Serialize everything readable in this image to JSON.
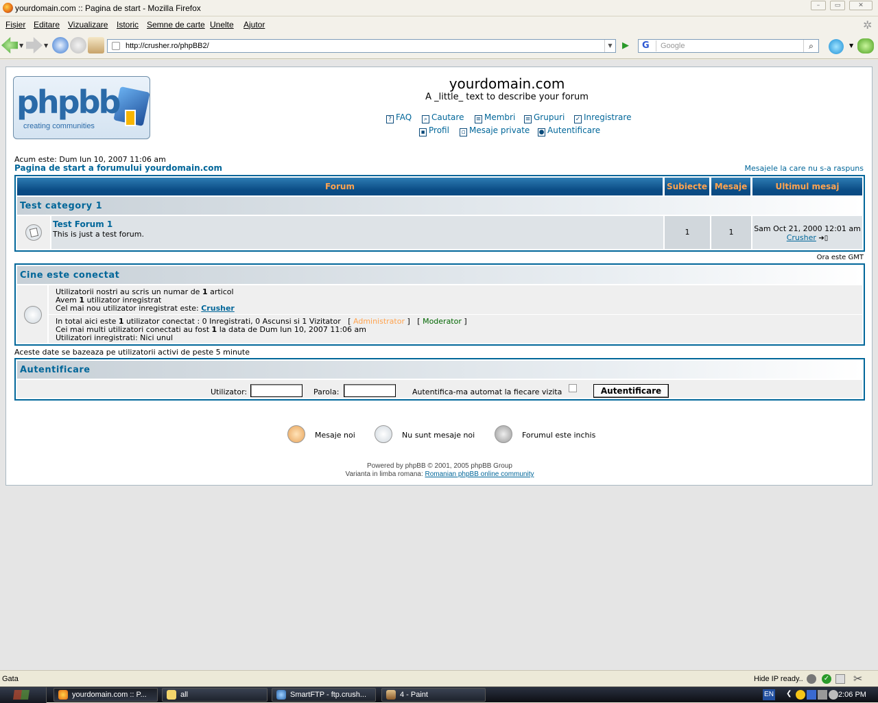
{
  "window": {
    "title": "yourdomain.com :: Pagina de start - Mozilla Firefox"
  },
  "menu": [
    "Fișier",
    "Editare",
    "Vizualizare",
    "Istoric",
    "Semne de carte",
    "Unelte",
    "Ajutor"
  ],
  "nav": {
    "url": "http://crusher.ro/phpBB2/",
    "search_placeholder": "Google"
  },
  "header": {
    "logo_text": "phpbb",
    "logo_tagline": "creating communities",
    "site_title": "yourdomain.com",
    "site_desc": "A _little_ text to describe your forum",
    "links_row1": [
      "FAQ",
      "Cautare",
      "Membri",
      "Grupuri",
      "Inregistrare"
    ],
    "links_row2": [
      "Profil",
      "Mesaje private",
      "Autentificare"
    ]
  },
  "info": {
    "now": "Acum este: Dum Iun 10, 2007 11:06 am",
    "index_link": "Pagina de start a forumului yourdomain.com",
    "unanswered": "Mesajele la care nu s-a raspuns"
  },
  "forum_table": {
    "headers": [
      "Forum",
      "Subiecte",
      "Mesaje",
      "Ultimul mesaj"
    ],
    "category": "Test category 1",
    "forum": {
      "name": "Test Forum 1",
      "desc": "This is just a test forum.",
      "topics": "1",
      "posts": "1",
      "last_post_date": "Sam Oct 21, 2000 12:01 am",
      "last_post_user": "Crusher"
    },
    "timezone": "Ora este GMT"
  },
  "whos_online": {
    "title": "Cine este conectat",
    "l1_pre": "Utilizatorii nostri au scris un numar de ",
    "l1_num": "1",
    "l1_post": " articol",
    "l2_pre": "Avem ",
    "l2_num": "1",
    "l2_post": " utilizator inregistrat",
    "l3_pre": "Cel mai nou utilizator inregistrat este: ",
    "l3_user": "Crusher",
    "l4_pre": "In total aici este ",
    "l4_num": "1",
    "l4_post": " utilizator conectat : 0 Inregistrati, 0 Ascunsi si 1 Vizitator   [ ",
    "admin": "Administrator",
    "mid": " ]   [ ",
    "mod": "Moderator",
    "end": " ]",
    "l5_pre": "Cei mai multi utilizatori conectati au fost ",
    "l5_num": "1",
    "l5_post": " la data de Dum Iun 10, 2007 11:06 am",
    "l6": "Utilizatori inregistrati: Nici unul",
    "note": "Aceste date se bazeaza pe utilizatorii activi de peste 5 minute"
  },
  "login": {
    "title": "Autentificare",
    "user_label": "Utilizator:",
    "pass_label": "Parola:",
    "auto_label": "Autentifica-ma automat la fiecare vizita",
    "button": "Autentificare"
  },
  "legend": [
    "Mesaje noi",
    "Nu sunt mesaje noi",
    "Forumul este inchis"
  ],
  "footer": {
    "powered": "Powered by phpBB © 2001, 2005 phpBB Group",
    "ro_pre": "Varianta in limba romana: ",
    "ro_link": "Romanian phpBB online community"
  },
  "status": {
    "text": "Gata",
    "hide_ip": "Hide IP ready.."
  },
  "taskbar": {
    "tasks": [
      "yourdomain.com :: P...",
      "all",
      "SmartFTP - ftp.crush...",
      "4 - Paint"
    ],
    "lang": "EN",
    "clock": "2:06 PM"
  }
}
